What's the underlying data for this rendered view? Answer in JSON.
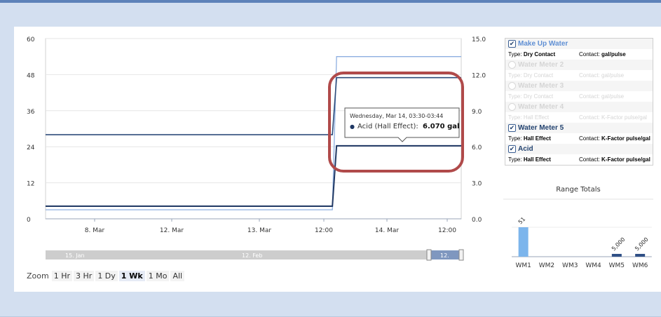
{
  "colors": {
    "acid": "#1f3864",
    "water_meter_5": "#2e4d7b",
    "make_up_water": "#8eafe0",
    "annotation": "#b04a4a",
    "grid": "#e6e6e6",
    "range_bar_wm1": "#7cb5ec",
    "range_bar_dark": "#2f4f86"
  },
  "chart_data": [
    {
      "type": "line",
      "x_ticks": [
        "8. Mar",
        "12. Mar",
        "13. Mar",
        "12:00",
        "14. Mar",
        "12:00"
      ],
      "y_left_ticks": [
        "0",
        "12",
        "24",
        "36",
        "48",
        "60"
      ],
      "y_left_range": [
        0,
        60
      ],
      "y_right_ticks": [
        "0.0",
        "3.0",
        "6.0",
        "9.0",
        "12.0",
        "15.0"
      ],
      "y_right_range": [
        0,
        15
      ],
      "x_step_position": 0.69,
      "series": [
        {
          "name": "Make Up Water",
          "axis": "left",
          "start": 3.0,
          "end": 54.0
        },
        {
          "name": "Water Meter 5",
          "axis": "left",
          "start": 28.0,
          "end": 47.0
        },
        {
          "name": "Acid",
          "axis": "left",
          "start": 4.2,
          "end": 24.3
        }
      ],
      "tooltip": {
        "date": "Wednesday, Mar 14, 03:30-03:44",
        "bullet": "●",
        "series": "Acid (Hall Effect):",
        "value": "6.070 gal"
      },
      "navigator": {
        "labels": [
          "15. Jan",
          "12. Feb",
          "12."
        ]
      },
      "zoom": {
        "label": "Zoom",
        "buttons": [
          "1 Hr",
          "3 Hr",
          "1 Dy",
          "1 Wk",
          "1 Mo",
          "All"
        ],
        "active": "1 Wk"
      },
      "grid": true
    },
    {
      "type": "bar",
      "title": "Range Totals",
      "categories": [
        "WM1",
        "WM2",
        "WM3",
        "WM4",
        "WM5",
        "WM6"
      ],
      "values": [
        51,
        0,
        0,
        0,
        5000,
        5000
      ],
      "data_labels": [
        "51",
        "",
        "",
        "",
        "5,000",
        "5,000"
      ]
    }
  ],
  "legend": {
    "items": [
      {
        "name": "Make Up Water",
        "enabled": true,
        "check_icon": "check-icon",
        "type_key": "Type:",
        "type": "Dry Contact",
        "contact_key": "Contact:",
        "contact": "gal/pulse"
      },
      {
        "name": "Water Meter 2",
        "enabled": false,
        "check_icon": "check-icon",
        "type_key": "Type:",
        "type": "Dry Contact",
        "contact_key": "Contact:",
        "contact": "gal/pulse"
      },
      {
        "name": "Water Meter 3",
        "enabled": false,
        "check_icon": "check-icon",
        "type_key": "Type:",
        "type": "Dry Contact",
        "contact_key": "Contact:",
        "contact": "gal/pulse"
      },
      {
        "name": "Water Meter 4",
        "enabled": false,
        "check_icon": "check-icon",
        "type_key": "Type:",
        "type": "Hall Effect",
        "contact_key": "Contact:",
        "contact": "K-Factor pulse/gal"
      },
      {
        "name": "Water Meter 5",
        "enabled": true,
        "check_icon": "check-icon",
        "type_key": "Type:",
        "type": "Hall Effect",
        "contact_key": "Contact:",
        "contact": "K-Factor pulse/gal"
      },
      {
        "name": "Acid",
        "enabled": true,
        "check_icon": "check-icon",
        "type_key": "Type:",
        "type": "Hall Effect",
        "contact_key": "Contact:",
        "contact": "K-Factor pulse/gal"
      }
    ]
  }
}
